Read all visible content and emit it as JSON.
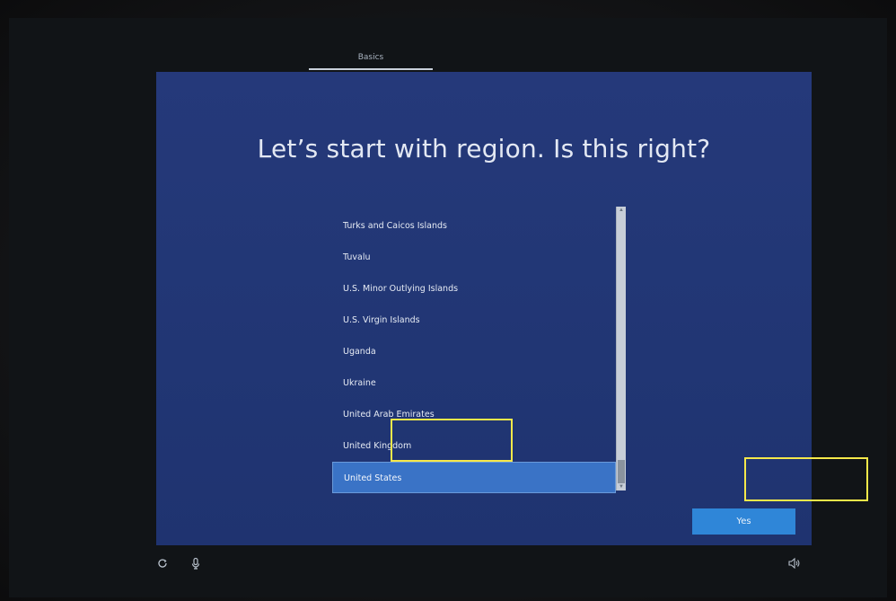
{
  "tabs": [
    {
      "label": "Basics"
    }
  ],
  "title": "Let’s start with region. Is this right?",
  "region_list": {
    "items": [
      {
        "label": "Turks and Caicos Islands"
      },
      {
        "label": "Tuvalu"
      },
      {
        "label": "U.S. Minor Outlying Islands"
      },
      {
        "label": "U.S. Virgin Islands"
      },
      {
        "label": "Uganda"
      },
      {
        "label": "Ukraine"
      },
      {
        "label": "United Arab Emirates"
      },
      {
        "label": "United Kingdom"
      },
      {
        "label": "United States"
      }
    ],
    "selected": "United States"
  },
  "buttons": {
    "yes_label": "Yes"
  },
  "icons": {
    "accessibility": "accessibility-icon",
    "microphone": "microphone-icon",
    "volume": "volume-icon",
    "scroll_up": "chevron-up-icon",
    "scroll_down": "chevron-down-icon"
  },
  "colors": {
    "panel_background": "#243a7c",
    "selected_item": "#3a73c6",
    "primary_button": "#2f86d8",
    "highlight_annotation": "#f5e84a"
  }
}
